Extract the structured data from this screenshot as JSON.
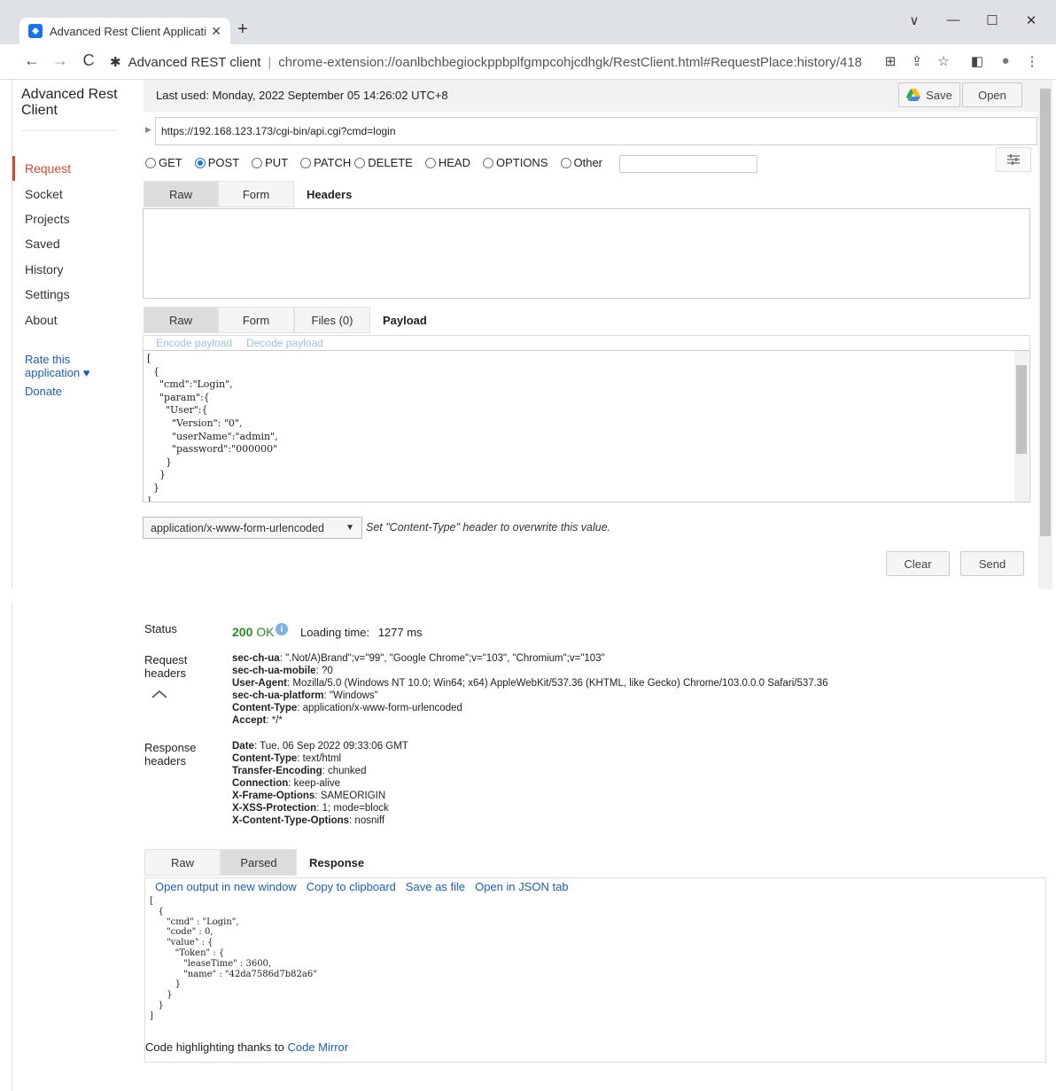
{
  "browser": {
    "tab_title": "Advanced Rest Client Applicati",
    "tab_close": "✕",
    "new_tab": "+",
    "window_controls": [
      "∨",
      "—",
      "☐",
      "✕"
    ],
    "nav": [
      "←",
      "→",
      "C"
    ],
    "extension_name": "Advanced REST client",
    "url_separator": "|",
    "url": "chrome-extension://oanlbchbegiockppbplfgmpcohjcdhgk/RestClient.html#RequestPlace:history/418",
    "toolbar_icons": [
      "⊞",
      "⇪",
      "☆",
      "◧",
      "●",
      "⋮"
    ]
  },
  "sidebar": {
    "brand": "Advanced Rest Client",
    "items": [
      {
        "label": "Request"
      },
      {
        "label": "Socket"
      },
      {
        "label": "Projects"
      },
      {
        "label": "Saved"
      },
      {
        "label": "History"
      },
      {
        "label": "Settings"
      },
      {
        "label": "About"
      }
    ],
    "rate": "Rate this application ♥",
    "donate": "Donate"
  },
  "request": {
    "last_used": "Last used: Monday, 2022 September 05 14:26:02 UTC+8",
    "save_label": "Save",
    "open_label": "Open",
    "url": "https://192.168.123.173/cgi-bin/api.cgi?cmd=login",
    "methods": [
      "GET",
      "POST",
      "PUT",
      "PATCH",
      "DELETE",
      "HEAD",
      "OPTIONS",
      "Other"
    ],
    "selected_method": "POST",
    "headers_tabs": [
      "Raw",
      "Form"
    ],
    "headers_title": "Headers",
    "payload_tabs": [
      "Raw",
      "Form",
      "Files (0)"
    ],
    "payload_title": "Payload",
    "encode_label": "Encode payload",
    "decode_label": "Decode payload",
    "payload_body": "[\n  {\n    \"cmd\":\"Login\",\n    \"param\":{\n      \"User\":{\n        \"Version\": \"0\",\n        \"userName\":\"admin\",\n        \"password\":\"000000\"\n      }\n    }\n  }\n]",
    "content_type": "application/x-www-form-urlencoded",
    "content_type_hint": "Set \"Content-Type\" header to overwrite this value.",
    "clear_label": "Clear",
    "send_label": "Send"
  },
  "response": {
    "status_label": "Status",
    "status_code": "200",
    "status_text": "OK",
    "loading_label": "Loading time:",
    "loading_value": "1277 ms",
    "request_headers_label": "Request headers",
    "request_headers": [
      {
        "name": "sec-ch-ua",
        "value": "\".Not/A)Brand\";v=\"99\", \"Google Chrome\";v=\"103\", \"Chromium\";v=\"103\""
      },
      {
        "name": "sec-ch-ua-mobile",
        "value": "?0"
      },
      {
        "name": "User-Agent",
        "value": "Mozilla/5.0 (Windows NT 10.0; Win64; x64) AppleWebKit/537.36 (KHTML, like Gecko) Chrome/103.0.0.0 Safari/537.36"
      },
      {
        "name": "sec-ch-ua-platform",
        "value": "\"Windows\""
      },
      {
        "name": "Content-Type",
        "value": "application/x-www-form-urlencoded"
      },
      {
        "name": "Accept",
        "value": "*/*"
      }
    ],
    "response_headers_label": "Response headers",
    "response_headers": [
      {
        "name": "Date",
        "value": "Tue, 06 Sep 2022 09:33:06 GMT"
      },
      {
        "name": "Content-Type",
        "value": "text/html"
      },
      {
        "name": "Transfer-Encoding",
        "value": "chunked"
      },
      {
        "name": "Connection",
        "value": "keep-alive"
      },
      {
        "name": "X-Frame-Options",
        "value": "SAMEORIGIN"
      },
      {
        "name": "X-XSS-Protection",
        "value": "1; mode=block"
      },
      {
        "name": "X-Content-Type-Options",
        "value": "nosniff"
      }
    ],
    "tabs": [
      "Raw",
      "Parsed"
    ],
    "tabs_title": "Response",
    "links": [
      "Open output in new window",
      "Copy to clipboard",
      "Save as file",
      "Open in JSON tab"
    ],
    "body": "[\n   {\n      \"cmd\" : \"Login\",\n      \"code\" : 0,\n      \"value\" : {\n         \"Token\" : {\n            \"leaseTime\" : 3600,\n            \"name\" : \"42da7586d7b82a6\"\n         }\n      }\n   }\n]",
    "credits_prefix": "Code highlighting thanks to",
    "credits_link": "Code Mirror"
  },
  "colors": {
    "accent_active": "#d14836",
    "link": "#1a5fb4",
    "status_ok": "#2a8d2a",
    "radio_checked": "#1a73e8"
  }
}
